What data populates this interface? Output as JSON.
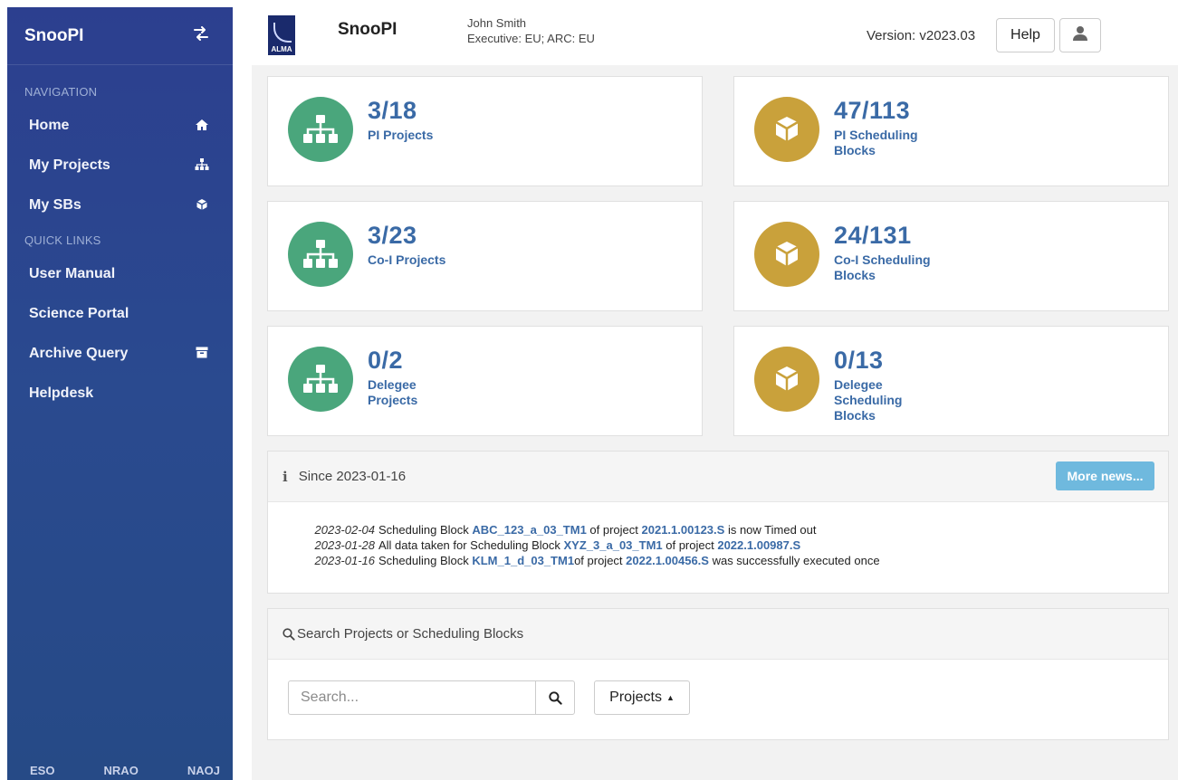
{
  "sidebar": {
    "title": "SnooPI",
    "toggle_icon": "arrows-swap-icon",
    "nav_heading": "NAVIGATION",
    "nav_items": [
      {
        "label": "Home",
        "icon": "home-icon"
      },
      {
        "label": "My Projects",
        "icon": "sitemap-icon"
      },
      {
        "label": "My SBs",
        "icon": "cube-icon"
      }
    ],
    "quick_heading": "QUICK LINKS",
    "quick_items": [
      {
        "label": "User Manual"
      },
      {
        "label": "Science Portal"
      },
      {
        "label": "Archive Query",
        "icon": "archive-icon"
      },
      {
        "label": "Helpdesk"
      }
    ],
    "footer": [
      "ESO",
      "NRAO",
      "NAOJ"
    ]
  },
  "header": {
    "logo_text": "ALMA",
    "app_name": "SnooPI",
    "user_name": "John Smith",
    "user_role": "Executive: EU; ARC: EU",
    "version": "Version: v2023.03",
    "help_label": "Help"
  },
  "stats": [
    {
      "value": "3/18",
      "label": "PI Projects",
      "icon": "sitemap-icon",
      "color": "#4aa67c"
    },
    {
      "value": "47/113",
      "label": "PI Scheduling Blocks",
      "icon": "cube-icon",
      "color": "#c9a13b"
    },
    {
      "value": "3/23",
      "label": "Co-I Projects",
      "icon": "sitemap-icon",
      "color": "#4aa67c"
    },
    {
      "value": "24/131",
      "label": "Co-I Scheduling Blocks",
      "icon": "cube-icon",
      "color": "#c9a13b"
    },
    {
      "value": "0/2",
      "label": "Delegee Projects",
      "icon": "sitemap-icon",
      "color": "#4aa67c"
    },
    {
      "value": "0/13",
      "label": "Delegee Scheduling Blocks",
      "icon": "cube-icon",
      "color": "#c9a13b"
    }
  ],
  "news": {
    "info_icon": "info-icon",
    "since": "Since 2023-01-16",
    "more_label": "More news...",
    "items": [
      {
        "date": "2023-02-04",
        "pre": "Scheduling Block ",
        "sb": "ABC_123_a_03_TM1",
        "mid": " of project ",
        "project": "2021.1.00123.S",
        "post": " is now Timed out"
      },
      {
        "date": "2023-01-28",
        "pre": "All data taken for Scheduling Block ",
        "sb": "XYZ_3_a_03_TM1",
        "mid": " of project ",
        "project": "2022.1.00987.S",
        "post": ""
      },
      {
        "date": "2023-01-16",
        "pre": "Scheduling Block ",
        "sb": "KLM_1_d_03_TM1",
        "mid": "of project ",
        "project": "2022.1.00456.S",
        "post": " was successfully executed once"
      }
    ]
  },
  "search": {
    "heading": "Search Projects or Scheduling Blocks",
    "placeholder": "Search...",
    "type_label": "Projects"
  }
}
